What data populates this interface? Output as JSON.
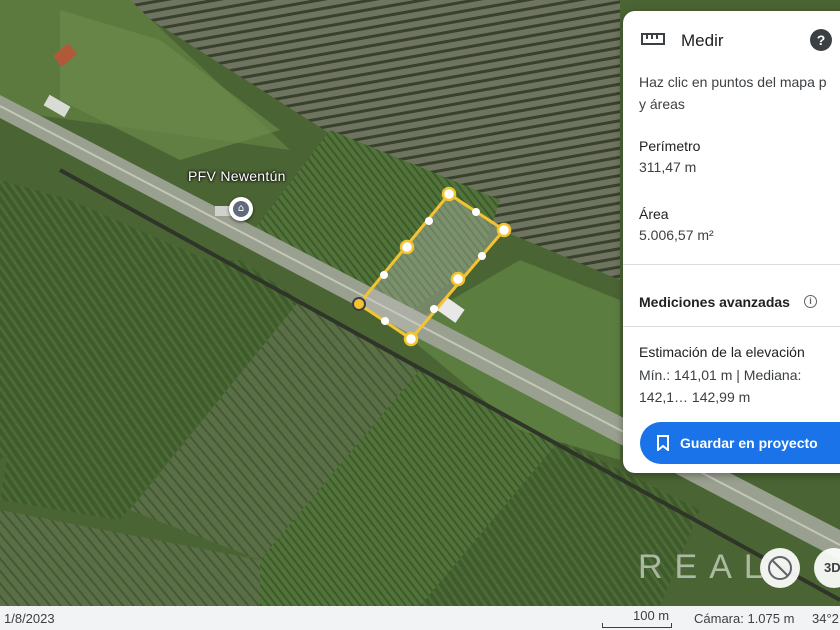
{
  "map": {
    "place_label": "PFV Newentún",
    "place_icon": "bank-icon"
  },
  "measure_panel": {
    "title": "Medir",
    "instructions_line1": "Haz clic en puntos del mapa p",
    "instructions_line2": "y áreas",
    "perimeter_label": "Perímetro",
    "perimeter_value": "311,47 m",
    "area_label": "Área",
    "area_value": "5.006,57 m²",
    "advanced_label": "Mediciones avanzadas",
    "elevation_label": "Estimación de la elevación",
    "elevation_values": "Mín.: 141,01 m | Mediana: 142,1… 142,99 m",
    "save_button": "Guardar en proyecto",
    "accent_color": "#1a73e8"
  },
  "controls": {
    "button_3d": "3D",
    "watermark": "REAL"
  },
  "status_bar": {
    "imagery_date": "1/8/2023",
    "scale_label": "100 m",
    "camera": "Cámara: 1.075 m",
    "coordinates": "34°2"
  }
}
